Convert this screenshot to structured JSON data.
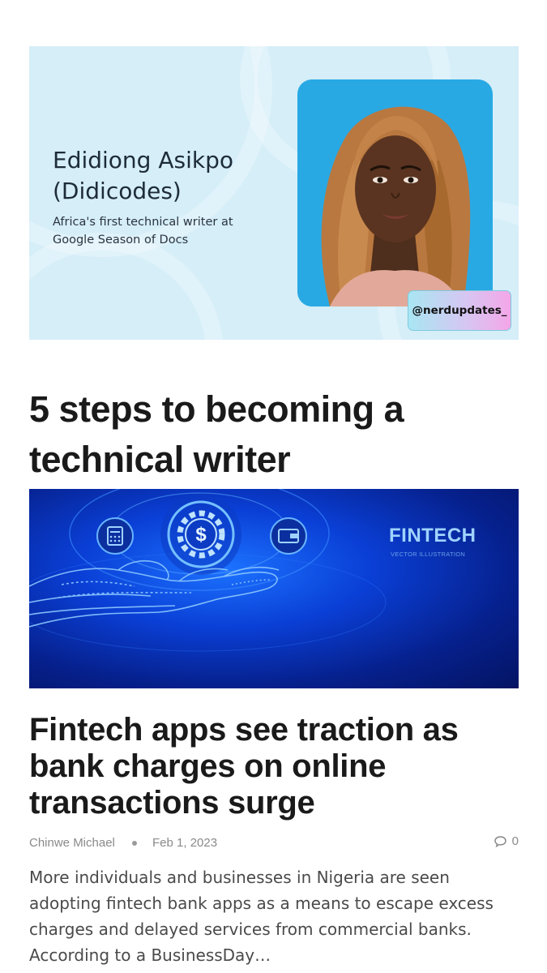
{
  "post_1": {
    "banner": {
      "name_line_1": "Edidiong Asikpo",
      "name_line_2": "(Didicodes)",
      "subtitle_line_1": "Africa's first technical writer at",
      "subtitle_line_2": "Google Season of Docs",
      "handle": "@nerdupdates_",
      "frame_color": "#29a9e4",
      "background_color": "#d5eef8"
    },
    "title": "5 steps to becoming a technical writer"
  },
  "post_2": {
    "image": {
      "label": "FINTECH",
      "sublabel": "VECTOR ILLUSTRATION",
      "icons": [
        "calculator-icon",
        "dollar-gear-icon",
        "wallet-icon",
        "digital-hand-icon"
      ],
      "accent_color": "#1c72ff"
    },
    "title": "Fintech apps see traction as bank charges on online transactions surge",
    "author": "Chinwe Michael",
    "date": "Feb 1, 2023",
    "comment_count": "0",
    "excerpt": "More individuals and businesses in Nigeria are seen adopting fintech bank apps as a means to escape excess charges and delayed services from commercial banks. According to a BusinessDay…"
  }
}
